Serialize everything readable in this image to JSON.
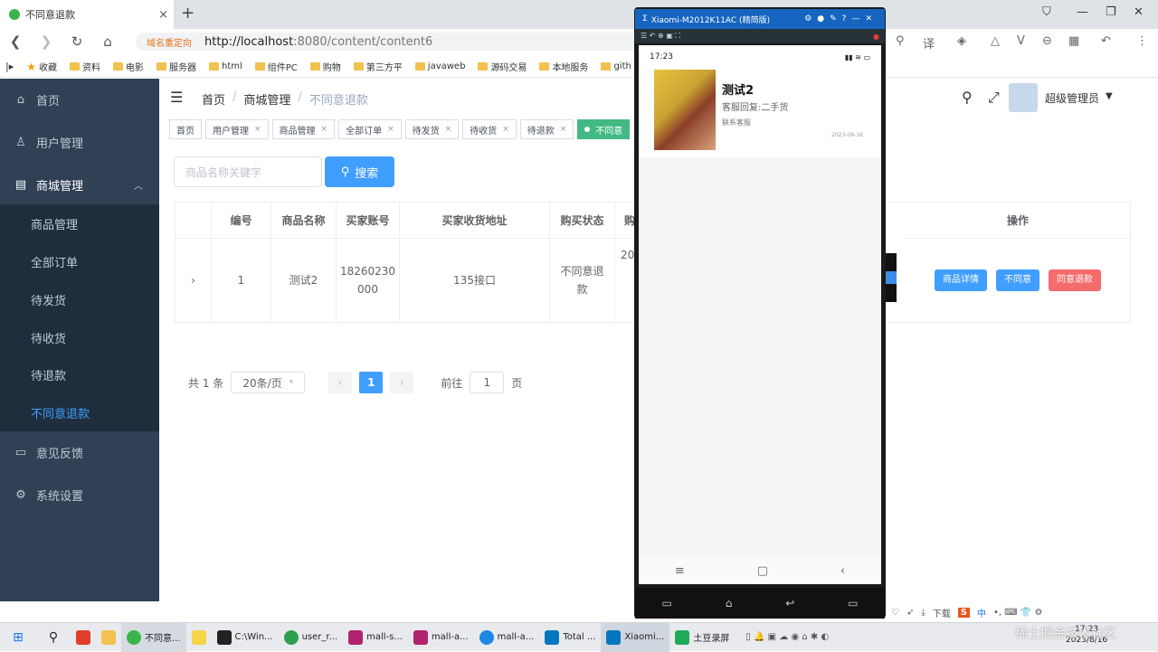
{
  "browser": {
    "tab_title": "不同意退款",
    "tab_close": "×",
    "new_tab": "+",
    "url_redirect": "域名重定向",
    "url_host": "http://localhost",
    "url_rest": ":8080/content/content6",
    "bookmarks": [
      "收藏",
      "资料",
      "电影",
      "服务器",
      "html",
      "组件PC",
      "购物",
      "第三方平",
      "javaweb",
      "源码交易",
      "本地服务",
      "gith"
    ]
  },
  "sidebar": {
    "items": [
      {
        "label": "首页",
        "icon": "home-icon"
      },
      {
        "label": "用户管理",
        "icon": "user-icon"
      },
      {
        "label": "商城管理",
        "icon": "document-icon"
      }
    ],
    "sub_items": [
      "商品管理",
      "全部订单",
      "待发货",
      "待收货",
      "待退款",
      "不同意退款"
    ],
    "bottom_items": [
      {
        "label": "意见反馈",
        "icon": "chat-icon"
      },
      {
        "label": "系统设置",
        "icon": "gear-icon"
      }
    ]
  },
  "header": {
    "breadcrumb": [
      "首页",
      "商城管理",
      "不同意退款"
    ],
    "username": "超级管理员"
  },
  "tags": [
    "首页",
    "用户管理",
    "商品管理",
    "全部订单",
    "待发货",
    "待收货",
    "待退款",
    "不同意"
  ],
  "search": {
    "placeholder": "商品名称关键字",
    "button": "搜索"
  },
  "table": {
    "headers": [
      "编号",
      "商品名称",
      "买家账号",
      "买家收货地址",
      "购买状态",
      "购",
      "操作"
    ],
    "row": {
      "id": "1",
      "name": "测试2",
      "account_line1": "18260230",
      "account_line2": "000",
      "address": "135接口",
      "status_line1": "不同意退",
      "status_line2": "款",
      "partial": "20"
    },
    "actions": [
      "商品详情",
      "不同意",
      "同意退款"
    ]
  },
  "pagination": {
    "total": "共 1 条",
    "page_size": "20条/页",
    "current": "1",
    "goto_label": "前往",
    "goto_value": "1",
    "page_suffix": "页"
  },
  "phone": {
    "window_title": "Xiaomi-M2012K11AC (精简版)",
    "time": "17:23",
    "item_name": "测试2",
    "item_reply": "客服回复:二手货",
    "item_contact": "联系客服",
    "item_date": "2023-08-16"
  },
  "taskbar": {
    "apps": [
      "不同意...",
      "C:\\Win...",
      "user_r...",
      "mall-s...",
      "mall-a...",
      "mall-a...",
      "Total ...",
      "Xiaomi...",
      "土豆录屏"
    ],
    "time": "17:23",
    "date": "2023/8/16",
    "ime": "中",
    "download": "下载",
    "watermark": "稀土掘金技术社区"
  },
  "colors": {
    "sidebar_bg": "#304156",
    "primary": "#409eff",
    "danger": "#f56c6c",
    "active_tag": "#42b983"
  }
}
